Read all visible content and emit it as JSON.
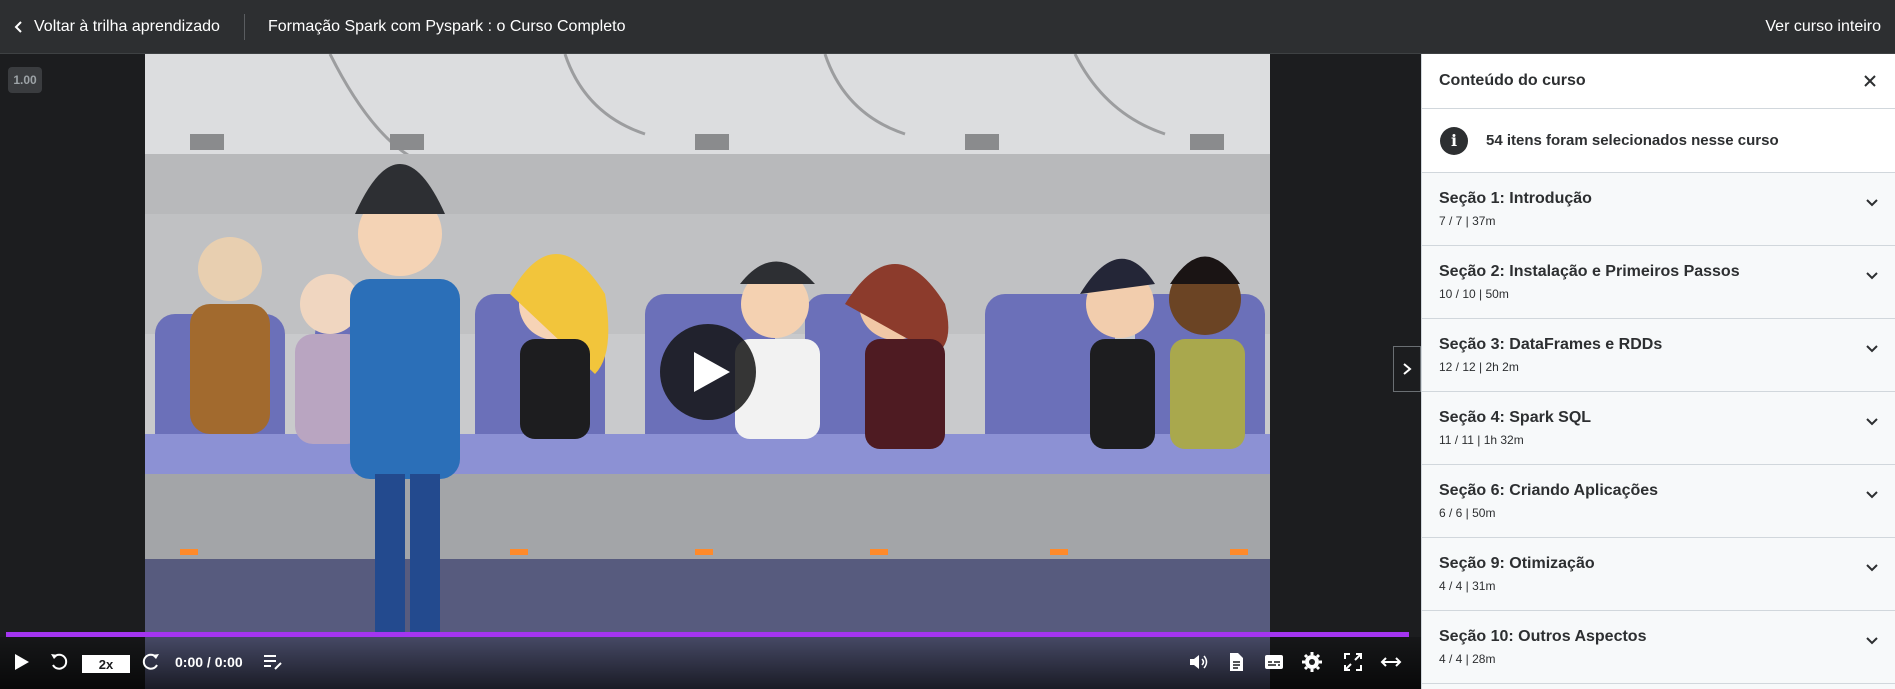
{
  "topbar": {
    "back_label": "Voltar à trilha aprendizado",
    "course_title": "Formação Spark com Pyspark : o Curso Completo",
    "view_full_label": "Ver curso inteiro"
  },
  "player": {
    "speed_indicator": "1.00",
    "speed_button": "2x",
    "time": "0:00 / 0:00",
    "progress_color": "#a435f0"
  },
  "sidebar": {
    "title": "Conteúdo do curso",
    "info_text": "54 itens foram selecionados nesse curso",
    "info_icon": "i",
    "sections": [
      {
        "title": "Seção 1: Introdução",
        "meta": "7 / 7 | 37m"
      },
      {
        "title": "Seção 2: Instalação e Primeiros Passos",
        "meta": "10 / 10 | 50m"
      },
      {
        "title": "Seção 3: DataFrames e RDDs",
        "meta": "12 / 12 | 2h 2m"
      },
      {
        "title": "Seção 4: Spark SQL",
        "meta": "11 / 11 | 1h 32m"
      },
      {
        "title": "Seção 6: Criando Aplicações",
        "meta": "6 / 6 | 50m"
      },
      {
        "title": "Seção 9: Otimização",
        "meta": "4 / 4 | 31m"
      },
      {
        "title": "Seção 10: Outros Aspectos",
        "meta": "4 / 4 | 28m"
      }
    ]
  },
  "icons": [
    "chevron-left-icon",
    "play-icon",
    "rewind-icon",
    "forward-icon",
    "transcript-icon",
    "volume-icon",
    "notes-icon",
    "captions-icon",
    "settings-icon",
    "fullscreen-icon",
    "expand-icon",
    "close-icon",
    "info-icon",
    "chevron-down-icon",
    "chevron-right-icon"
  ]
}
